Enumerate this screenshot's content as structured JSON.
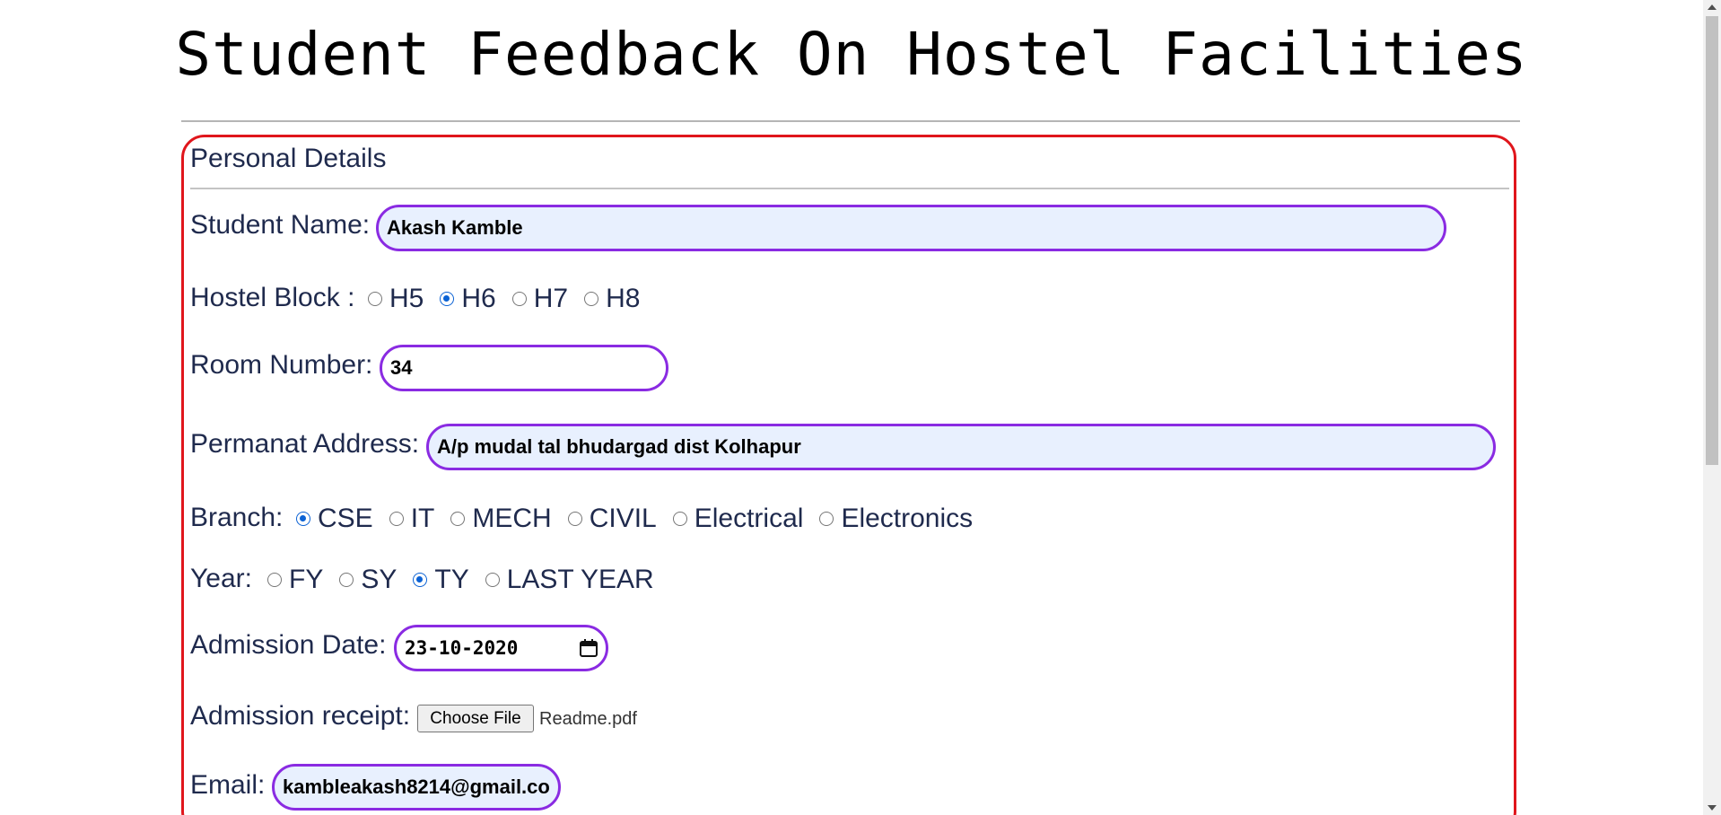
{
  "page_title": "Student Feedback On Hostel Facilities",
  "section_title": "Personal Details",
  "student_name": {
    "label": "Student Name:",
    "value": "Akash Kamble"
  },
  "hostel_block": {
    "label": "Hostel Block :",
    "options": [
      "H5",
      "H6",
      "H7",
      "H8"
    ],
    "selected": "H6"
  },
  "room_number": {
    "label": "Room Number:",
    "value": "34"
  },
  "address": {
    "label": "Permanat Address:",
    "value": "A/p mudal tal bhudargad dist Kolhapur"
  },
  "branch": {
    "label": "Branch:",
    "options": [
      "CSE",
      "IT",
      "MECH",
      "CIVIL",
      "Electrical",
      "Electronics"
    ],
    "selected": "CSE"
  },
  "year": {
    "label": "Year:",
    "options": [
      "FY",
      "SY",
      "TY",
      "LAST YEAR"
    ],
    "selected": "TY"
  },
  "admission_date": {
    "label": "Admission Date:",
    "value": "23-10-2020",
    "icon": "calendar-icon"
  },
  "admission_receipt": {
    "label": "Admission receipt:",
    "button_label": "Choose File",
    "file_name": "Readme.pdf"
  },
  "email": {
    "label": "Email:",
    "value": "kambleakash8214@gmail.co"
  },
  "colors": {
    "panel_border": "#e0161c",
    "field_border": "#8a2be2",
    "radio_selected": "#0b62d4"
  }
}
